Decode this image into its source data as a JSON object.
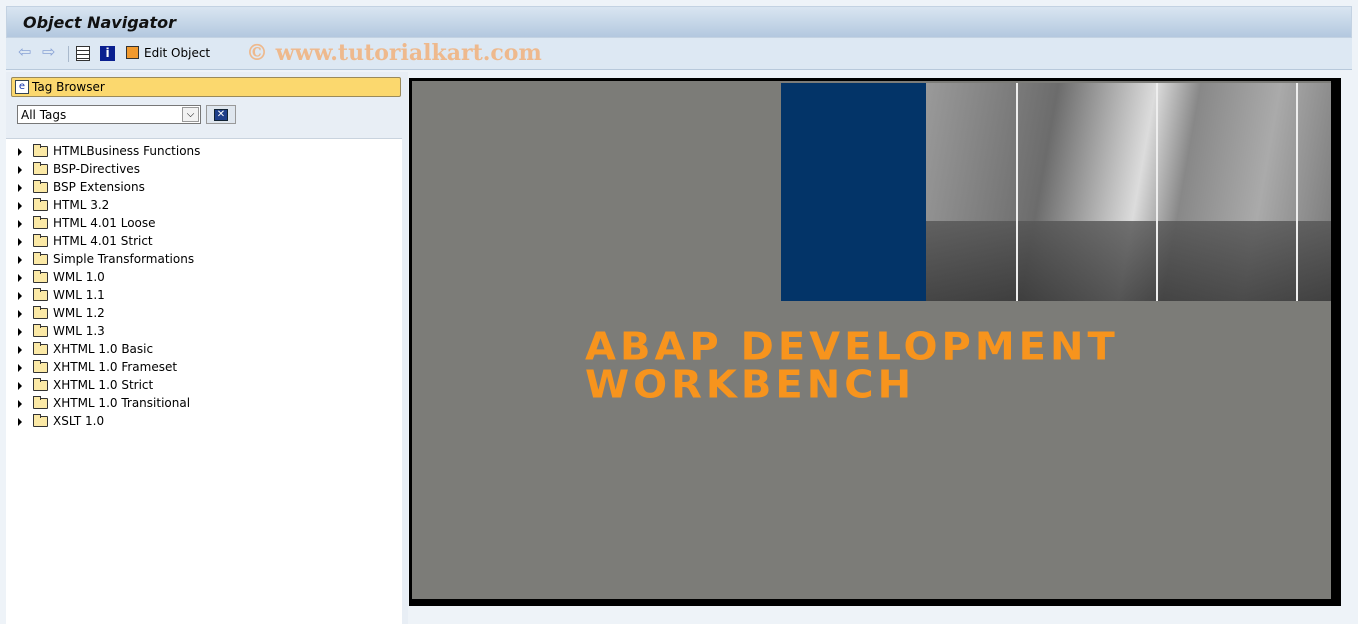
{
  "window": {
    "title": "Object Navigator"
  },
  "toolbar": {
    "back_icon": "arrow-left-icon",
    "forward_icon": "arrow-right-icon",
    "edit_object_label": "Edit Object",
    "watermark": "© www.tutorialkart.com"
  },
  "left_panel": {
    "header": "Tag Browser",
    "filter": {
      "selected": "All Tags"
    },
    "tree": [
      "HTMLBusiness Functions",
      "BSP-Directives",
      "BSP Extensions",
      "HTML 3.2",
      "HTML 4.01 Loose",
      "HTML 4.01 Strict",
      "Simple Transformations",
      "WML 1.0",
      "WML 1.1",
      "WML 1.2",
      "WML 1.3",
      "XHTML 1.0 Basic",
      "XHTML 1.0 Frameset",
      "XHTML 1.0 Strict",
      "XHTML 1.0 Transitional",
      "XSLT 1.0"
    ]
  },
  "splash": {
    "line1": "ABAP DEVELOPMENT",
    "line2": "WORKBENCH",
    "accent_color": "#f7941d",
    "block_color": "#033468"
  }
}
